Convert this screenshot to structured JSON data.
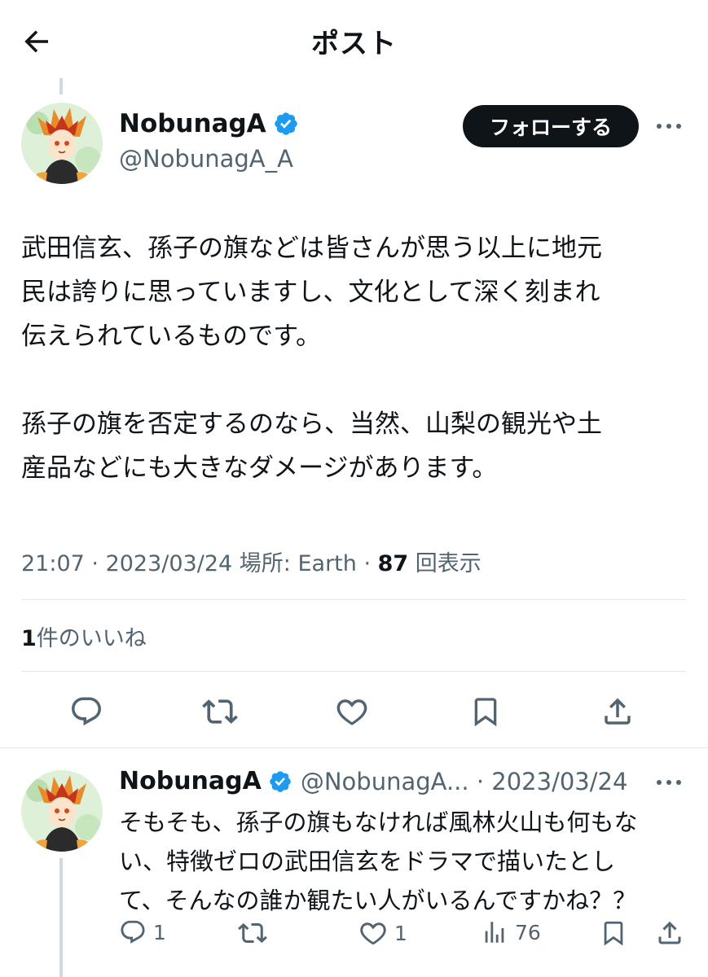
{
  "header": {
    "title": "ポスト"
  },
  "post": {
    "author_name": "NobunagA",
    "author_handle": "@NobunagA_A",
    "follow_label": "フォローする",
    "body": "武田信玄、孫子の旗などは皆さんが思う以上に地元\n民は誇りに思っていますし、文化として深く刻まれ\n伝えられているものです。\n\n孫子の旗を否定するのなら、当然、山梨の観光や土\n産品などにも大きなダメージがあります。",
    "time": "21:07",
    "date": "2023/03/24",
    "location_label": "場所: Earth",
    "views_count": "87",
    "views_label": "回表示",
    "likes_count": "1",
    "likes_label": "件のいいね"
  },
  "reply": {
    "author_name": "NobunagA",
    "author_handle": "@NobunagA...",
    "date": "2023/03/24",
    "body": "そもそも、孫子の旗もなければ風林火山も何もな\nい、特徴ゼロの武田信玄をドラマで描いたとし\nて、そんなの誰か観たい人がいるんですかね？？",
    "reply_count": "1",
    "like_count": "1",
    "views_count": "76"
  },
  "colors": {
    "text": "#0f1419",
    "secondary": "#536471",
    "verified": "#1d9bf0",
    "divider": "#e3e8eb",
    "thread_line": "#cfd9de"
  },
  "icons": [
    "back-arrow-icon",
    "verified-badge-icon",
    "more-icon",
    "reply-icon",
    "retweet-icon",
    "like-icon",
    "bookmark-icon",
    "share-icon",
    "views-icon"
  ]
}
